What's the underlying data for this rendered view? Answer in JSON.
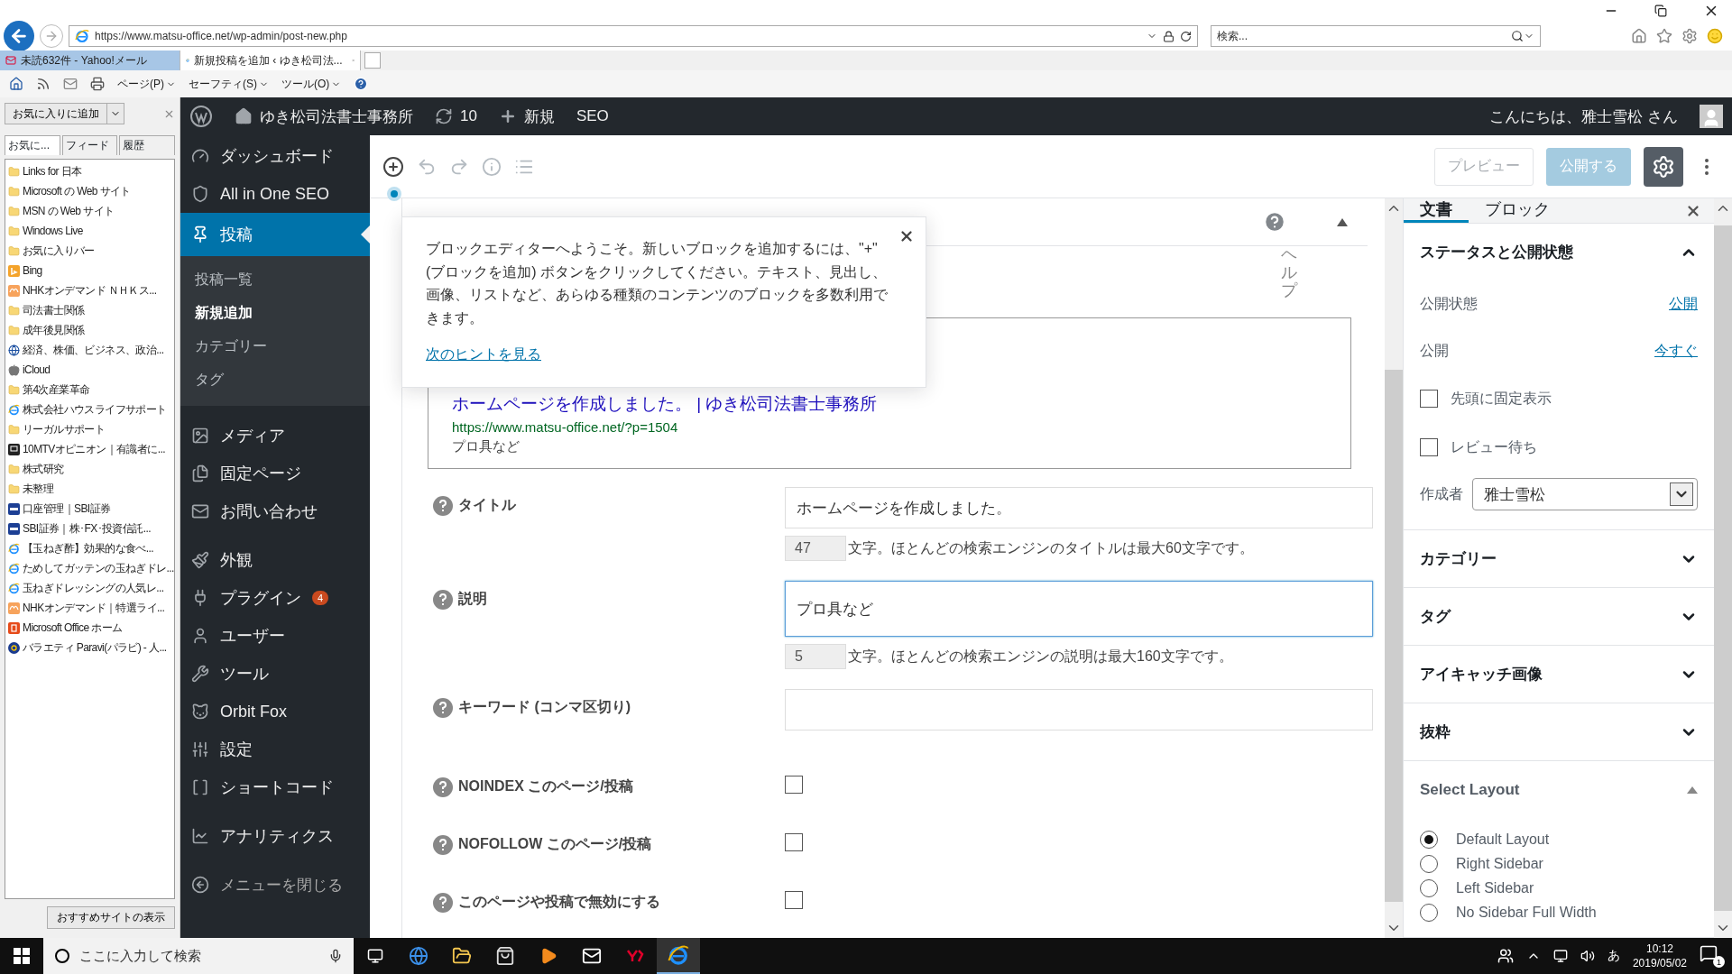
{
  "browser": {
    "url": "https://www.matsu-office.net/wp-admin/post-new.php",
    "search_placeholder": "検索...",
    "tabs": [
      {
        "label": "未読632件 - Yahoo!メール",
        "selected": false
      },
      {
        "label": "新規投稿を追加 ‹ ゆき松司法...",
        "selected": true
      }
    ],
    "menus": [
      "ページ(P)",
      "セーフティ(S)",
      "ツール(O)"
    ]
  },
  "favorites": {
    "add_button": "お気に入りに追加",
    "tabs": [
      {
        "label": "お気に...",
        "selected": true
      },
      {
        "label": "フィード",
        "selected": false
      },
      {
        "label": "履歴",
        "selected": false
      }
    ],
    "items": [
      {
        "label": "Links for 日本",
        "kind": "folder"
      },
      {
        "label": "Microsoft の Web サイト",
        "kind": "folder"
      },
      {
        "label": "MSN の Web サイト",
        "kind": "folder"
      },
      {
        "label": "Windows Live",
        "kind": "folder"
      },
      {
        "label": "お気に入りバー",
        "kind": "folder"
      },
      {
        "label": "Bing",
        "kind": "bing"
      },
      {
        "label": "NHKオンデマンド ＮＨＫス...",
        "kind": "nhk"
      },
      {
        "label": "司法書士関係",
        "kind": "folder"
      },
      {
        "label": "成年後見関係",
        "kind": "folder"
      },
      {
        "label": "経済、株価、ビジネス、政治...",
        "kind": "globe"
      },
      {
        "label": "iCloud",
        "kind": "apple"
      },
      {
        "label": "第4次産業革命",
        "kind": "folder"
      },
      {
        "label": "株式会社ハウスライフサポート",
        "kind": "ie"
      },
      {
        "label": "リーガルサポート",
        "kind": "folder"
      },
      {
        "label": "10MTVオピニオン｜有識者に...",
        "kind": "tv"
      },
      {
        "label": "株式研究",
        "kind": "folder"
      },
      {
        "label": "未整理",
        "kind": "folder"
      },
      {
        "label": "口座管理｜SBI証券",
        "kind": "sbi"
      },
      {
        "label": "SBI証券｜株･FX･投資信託...",
        "kind": "sbi"
      },
      {
        "label": "【玉ねぎ酢】効果的な食べ...",
        "kind": "ie"
      },
      {
        "label": "ためしてガッテンの玉ねぎドレ...",
        "kind": "ie"
      },
      {
        "label": "玉ねぎドレッシングの人気レ...",
        "kind": "ie"
      },
      {
        "label": "NHKオンデマンド｜特選ライ...",
        "kind": "nhk"
      },
      {
        "label": "Microsoft Office ホーム",
        "kind": "office"
      },
      {
        "label": "バラエティ Paravi(パラビ) - 人...",
        "kind": "paravi"
      }
    ],
    "footer_button": "おすすめサイトの表示"
  },
  "admin_bar": {
    "site": "ゆき松司法書士事務所",
    "updates": "10",
    "new": "新規",
    "seo": "SEO",
    "greeting": "こんにちは、雅士雪松 さん"
  },
  "sidebar": {
    "groups": [
      [
        {
          "label": "ダッシュボード",
          "selected": false
        },
        {
          "label": "All in One SEO",
          "selected": false
        },
        {
          "label": "投稿",
          "selected": true,
          "children": [
            {
              "label": "投稿一覧",
              "selected": false
            },
            {
              "label": "新規追加",
              "selected": true
            },
            {
              "label": "カテゴリー",
              "selected": false
            },
            {
              "label": "タグ",
              "selected": false
            }
          ]
        }
      ],
      [
        {
          "label": "メディア",
          "selected": false
        },
        {
          "label": "固定ページ",
          "selected": false
        },
        {
          "label": "お問い合わせ",
          "selected": false
        }
      ],
      [
        {
          "label": "外観",
          "selected": false
        },
        {
          "label": "プラグイン",
          "selected": false,
          "badge": "4"
        },
        {
          "label": "ユーザー",
          "selected": false
        },
        {
          "label": "ツール",
          "selected": false
        },
        {
          "label": "Orbit Fox",
          "selected": false
        },
        {
          "label": "設定",
          "selected": false
        },
        {
          "label": "ショートコード",
          "selected": false
        }
      ],
      [
        {
          "label": "アナリティクス",
          "selected": false
        }
      ]
    ],
    "collapse": "メニューを閉じる"
  },
  "editor": {
    "preview_button": {
      "label": "プレビュー",
      "disabled": true
    },
    "publish_button": {
      "label": "公開する",
      "disabled": true
    },
    "tip": {
      "text": "ブロックエディターへようこそ。新しいブロックを追加するには、\"+\" (ブロックを追加) ボタンをクリックしてください。テキスト、見出し、画像、リストなど、あらゆる種類のコンテンツのブロックを多数利用できます。",
      "link": "次のヒントを見る"
    },
    "help": "ヘルプ",
    "snippet": {
      "title": "ホームページを作成しました。 | ゆき松司法書士事務所",
      "url": "https://www.matsu-office.net/?p=1504",
      "description": "プロ具など"
    },
    "fields": [
      {
        "kind": "text",
        "label": "タイトル",
        "value": "ホームページを作成しました。",
        "focused": false,
        "count": "47",
        "hint": "文字。ほとんどの検索エンジンのタイトルは最大60文字です。"
      },
      {
        "kind": "text",
        "label": "説明",
        "value": "プロ具など",
        "focused": true,
        "count": "5",
        "hint": "文字。ほとんどの検索エンジンの説明は最大160文字です。"
      },
      {
        "kind": "text",
        "label": "キーワード (コンマ区切り)",
        "focused": false
      },
      {
        "kind": "checkbox",
        "label": "NOINDEX このページ/投稿",
        "checked": false
      },
      {
        "kind": "checkbox",
        "label": "NOFOLLOW このページ/投稿",
        "checked": false
      },
      {
        "kind": "checkbox",
        "label": "このページや投稿で無効にする",
        "checked": false
      }
    ]
  },
  "panel": {
    "tabs": [
      {
        "label": "文書",
        "selected": true
      },
      {
        "label": "ブロック",
        "selected": false
      }
    ],
    "status": {
      "title": "ステータスと公開状態",
      "expanded": true,
      "visibility_label": "公開状態",
      "visibility_value": "公開",
      "publish_label": "公開",
      "publish_value": "今すぐ",
      "options": [
        {
          "label": "先頭に固定表示",
          "checked": false
        },
        {
          "label": "レビュー待ち",
          "checked": false
        }
      ],
      "author_label": "作成者",
      "author_value": "雅士雪松"
    },
    "sections": [
      {
        "title": "カテゴリー",
        "expanded": false
      },
      {
        "title": "タグ",
        "expanded": false
      },
      {
        "title": "アイキャッチ画像",
        "expanded": false
      },
      {
        "title": "抜粋",
        "expanded": false
      }
    ],
    "layout": {
      "title": "Select Layout",
      "expanded": true,
      "options": [
        {
          "label": "Default Layout",
          "selected": true
        },
        {
          "label": "Right Sidebar",
          "selected": false
        },
        {
          "label": "Left Sidebar",
          "selected": false
        },
        {
          "label": "No Sidebar Full Width",
          "selected": false
        }
      ]
    }
  },
  "taskbar": {
    "search_placeholder": "ここに入力して検索",
    "ime": "あ",
    "time": "10:12",
    "date": "2019/05/02",
    "notifications": "1"
  }
}
